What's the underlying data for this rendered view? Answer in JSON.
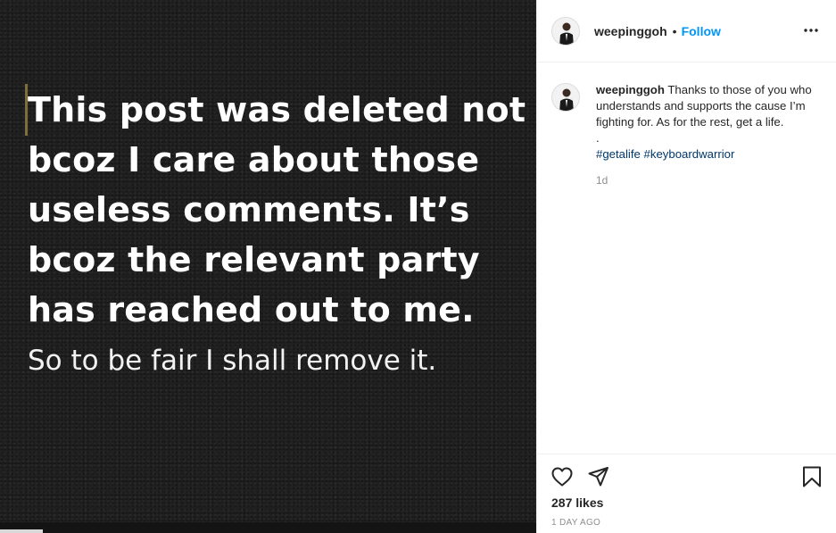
{
  "media": {
    "bold_text": "This post was deleted not\nbcoz I care about those\nuseless comments. It’s\nbcoz the relevant party\nhas reached out to me.",
    "regular_text": "So to be fair I shall remove it."
  },
  "header": {
    "username": "weepinggoh",
    "separator": "•",
    "follow_label": "Follow",
    "more_icon": "more-horizontal-icon"
  },
  "caption": {
    "username": "weepinggoh",
    "text": "Thanks to those of you who understands and supports the cause I’m fighting for. As for the rest, get a life.",
    "dot_line": ".",
    "hashtags": [
      "#getalife",
      "#keyboardwarrior"
    ],
    "age": "1d"
  },
  "actions": {
    "like_icon": "heart-icon",
    "share_icon": "paper-plane-icon",
    "save_icon": "bookmark-icon",
    "likes_text": "287 likes",
    "posted_text": "1 DAY AGO"
  },
  "colors": {
    "link_blue": "#0095f6",
    "hashtag_blue": "#00376b",
    "muted_gray": "#8e8e8e",
    "media_background": "#1f1f1f"
  }
}
